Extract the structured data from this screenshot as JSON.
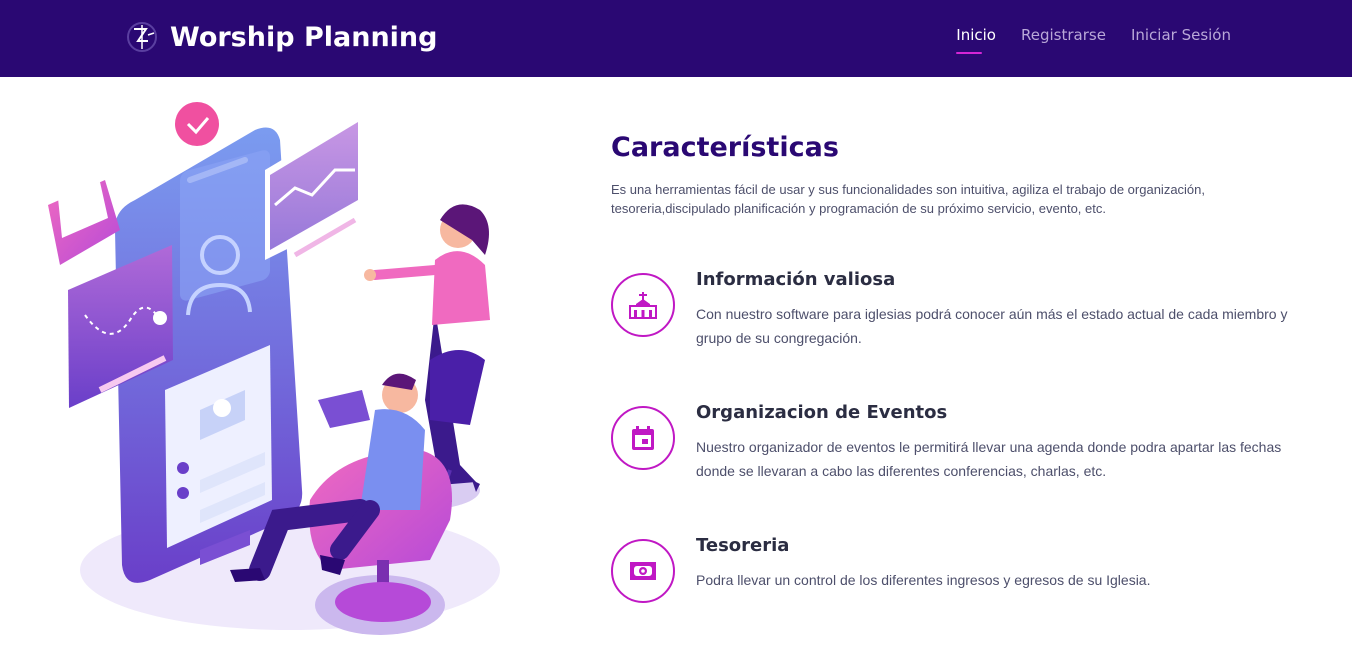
{
  "header": {
    "brand": "Worship Planning",
    "nav": [
      {
        "label": "Inicio",
        "active": true
      },
      {
        "label": "Registrarse",
        "active": false
      },
      {
        "label": "Iniciar Sesión",
        "active": false
      }
    ]
  },
  "colors": {
    "primary": "#2a0873",
    "accent": "#c018c4",
    "text": "#4d4f6b"
  },
  "main": {
    "title": "Características",
    "description": "Es una herramientas fácil de usar y sus funcionalidades son intuitiva, agiliza el trabajo de organización, tesoreria,discipulado planificación y programación de su próximo servicio, evento, etc.",
    "features": [
      {
        "icon": "church-icon",
        "title": "Información valiosa",
        "text": "Con nuestro software para iglesias podrá conocer aún más el estado actual de cada miembro y grupo de su congregación."
      },
      {
        "icon": "calendar-icon",
        "title": "Organizacion de Eventos",
        "text": "Nuestro organizador de eventos le permitirá llevar una agenda donde podra apartar las fechas donde se llevaran a cabo las diferentes conferencias, charlas, etc."
      },
      {
        "icon": "money-icon",
        "title": "Tesoreria",
        "text": "Podra llevar un control de los diferentes ingresos y egresos de su Iglesia."
      }
    ]
  }
}
